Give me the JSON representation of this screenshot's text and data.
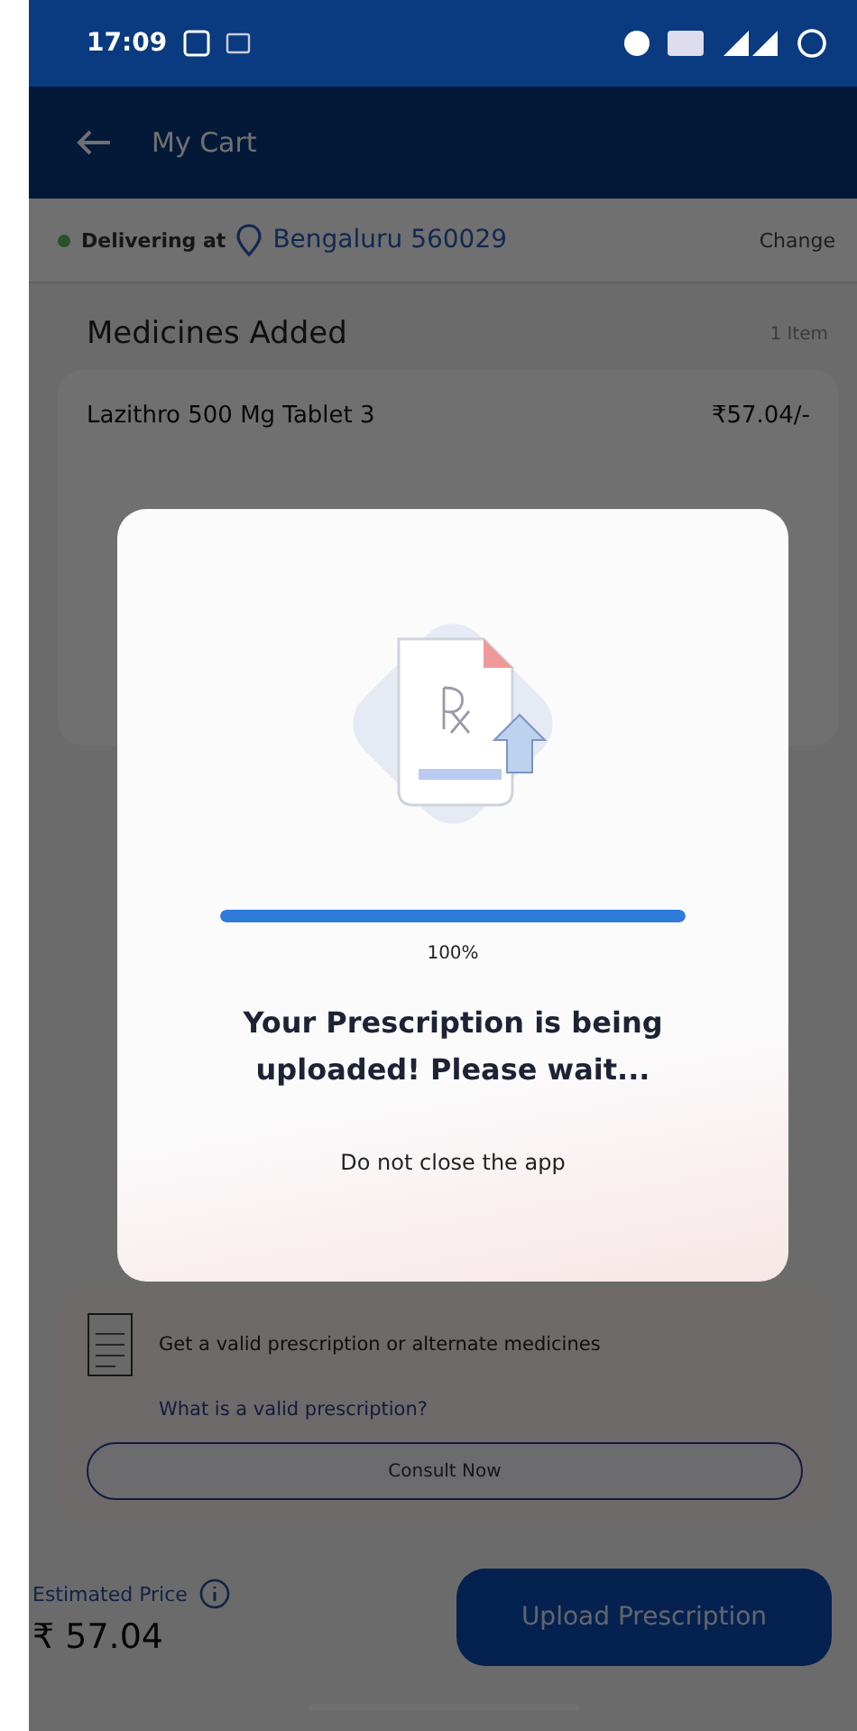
{
  "status_bar": {
    "time": "17:09"
  },
  "header": {
    "title": "My Cart"
  },
  "delivery": {
    "label": "Delivering at",
    "location": "Bengaluru 560029",
    "action": "Change"
  },
  "section": {
    "title": "Medicines Added",
    "count": "1 Item"
  },
  "medicines": [
    {
      "name": "Lazithro 500 Mg Tablet 3",
      "price": "₹57.04/-"
    }
  ],
  "prescription_card": {
    "text": "Get a valid prescription or alternate medicines",
    "link": "What is a valid prescription?",
    "button": "Consult Now"
  },
  "footer": {
    "label": "Estimated Price",
    "price": "₹ 57.04",
    "button": "Upload Prescription"
  },
  "dialog": {
    "progress": {
      "level": 1.0,
      "reading": "100%"
    },
    "message": "Your Prescription is being uploaded! Please wait...",
    "note": "Do not close the app"
  }
}
